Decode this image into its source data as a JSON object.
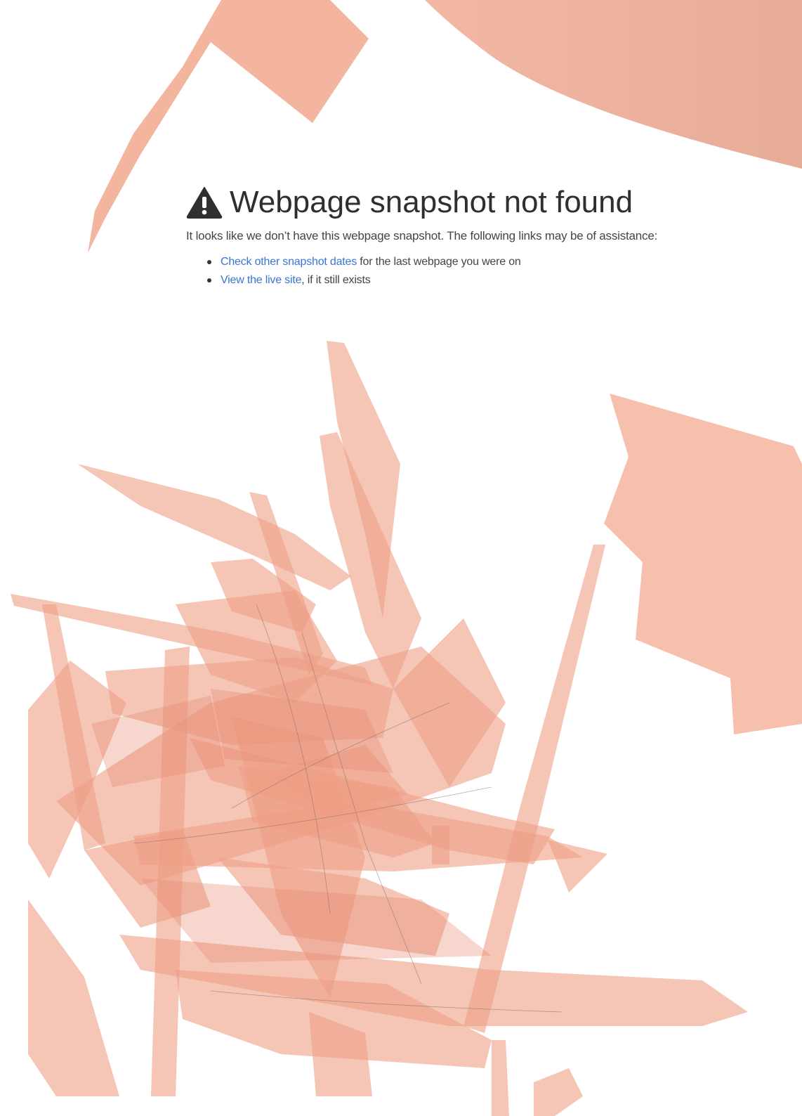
{
  "page": {
    "title": "Webpage snapshot not found",
    "title_icon": "warning-icon",
    "intro": "It looks like we don’t have this webpage snapshot. The following links may be of assistance:",
    "links": [
      {
        "link_text": "Check other snapshot dates",
        "rest_text": " for the last webpage you were on"
      },
      {
        "link_text": "View the live site",
        "rest_text": ", if it still exists"
      }
    ]
  },
  "colors": {
    "link": "#3a74d6",
    "title": "#2f2f2f",
    "body_text": "#444444",
    "art_fill": "#f0a98f"
  }
}
